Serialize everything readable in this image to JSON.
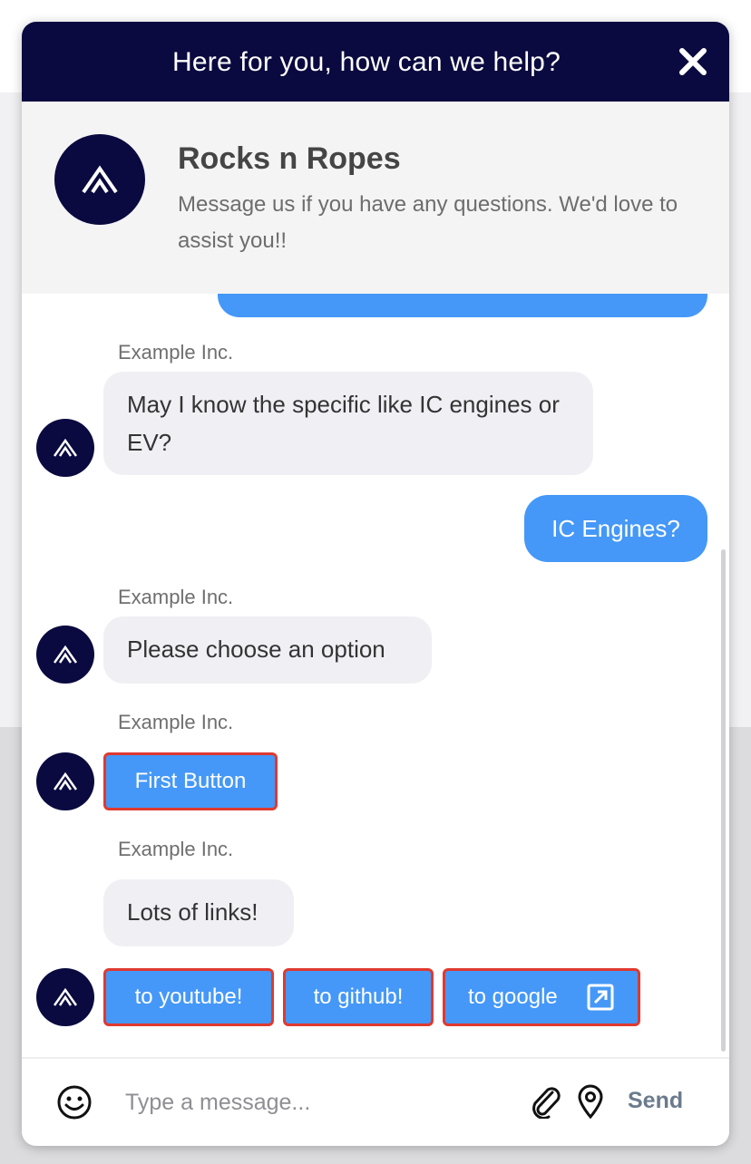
{
  "header": {
    "title": "Here for you, how can we help?",
    "close_icon": "close-icon"
  },
  "info": {
    "name": "Rocks n Ropes",
    "description": "Message us if you have any questions. We'd love to assist you!!",
    "logo_icon": "chevron-up-logo-icon"
  },
  "messages": [
    {
      "type": "bot",
      "sender": "Example Inc.",
      "text": "May I know the specific like IC engines or EV?"
    },
    {
      "type": "user",
      "text": "IC Engines?"
    },
    {
      "type": "bot",
      "sender": "Example Inc.",
      "text": "Please choose an option"
    },
    {
      "type": "bot-buttons",
      "sender": "Example Inc.",
      "buttons": [
        "First Button"
      ]
    },
    {
      "type": "bot",
      "sender": "Example Inc.",
      "text": "Lots of links!"
    },
    {
      "type": "bot-links",
      "links": [
        "to youtube!",
        "to github!",
        "to google"
      ]
    }
  ],
  "composer": {
    "placeholder": "Type a message...",
    "send_label": "Send",
    "icons": [
      "emoji-icon",
      "paperclip-icon",
      "location-pin-icon"
    ]
  },
  "colors": {
    "header_bg": "#0a0a40",
    "user_bubble": "#4598f7",
    "bot_bubble": "#f0eff4",
    "button_border": "#e0392f"
  }
}
